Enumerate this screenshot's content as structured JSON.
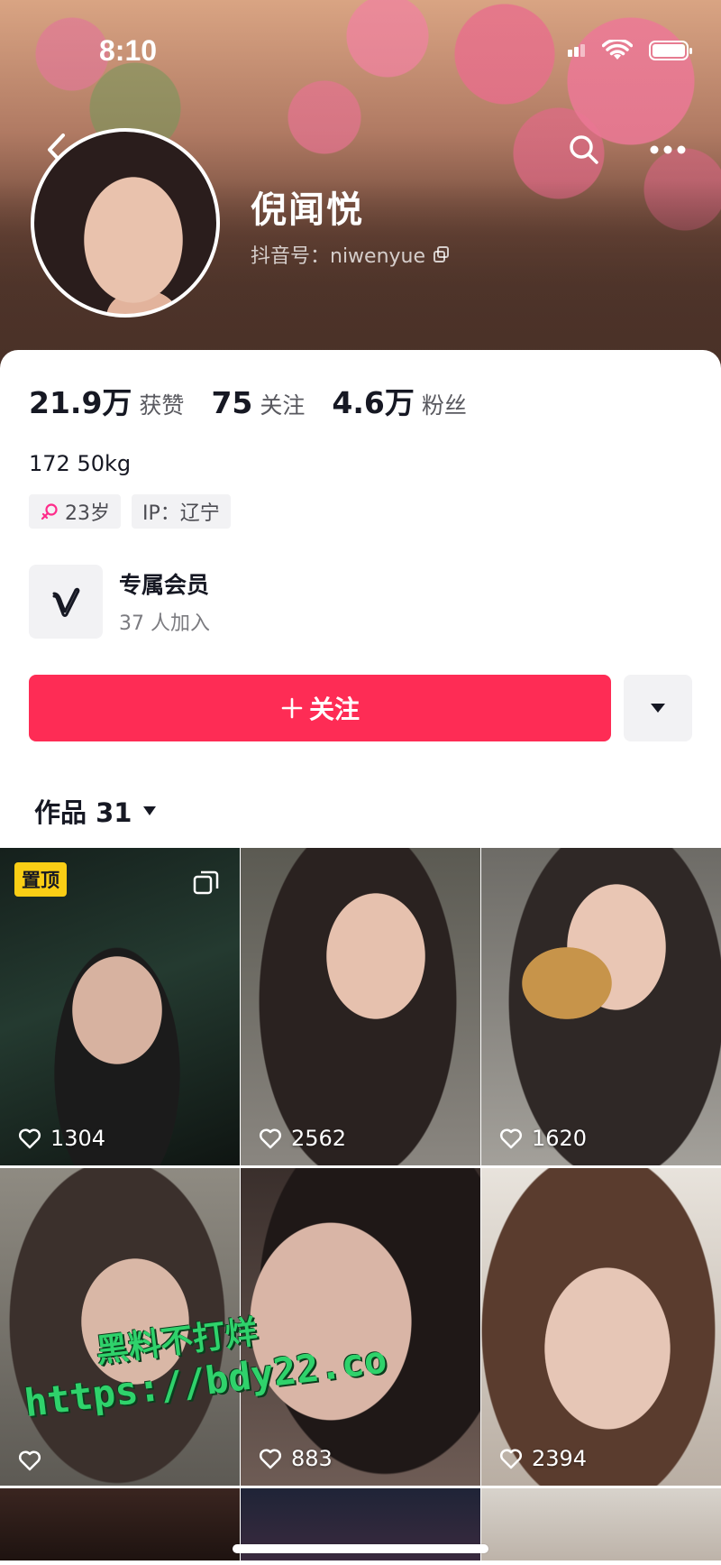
{
  "status_bar": {
    "time": "8:10"
  },
  "profile": {
    "name": "倪闻悦",
    "handle": "抖音号：niwenyue"
  },
  "stats": [
    {
      "value": "21.9万",
      "label": "获赞"
    },
    {
      "value": "75",
      "label": "关注"
    },
    {
      "value": "4.6万",
      "label": "粉丝"
    }
  ],
  "bio": "172 50kg",
  "tags": {
    "age": "23岁",
    "ip": "IP：辽宁"
  },
  "membership": {
    "title": "专属会员",
    "subtitle": "37 人加入"
  },
  "actions": {
    "follow_label": "关注"
  },
  "works_tab": {
    "label": "作品 31"
  },
  "grid": [
    {
      "likes": "1304",
      "pinned_label": "置顶"
    },
    {
      "likes": "2562"
    },
    {
      "likes": "1620"
    },
    {
      "likes": ""
    },
    {
      "likes": "883"
    },
    {
      "likes": "2394"
    }
  ],
  "watermark": {
    "line1": "黑料不打烊",
    "line2": "https://bdy22.co"
  },
  "colors": {
    "accent": "#fe2c55",
    "pin_badge": "#face15",
    "watermark": "#2fd26b"
  }
}
